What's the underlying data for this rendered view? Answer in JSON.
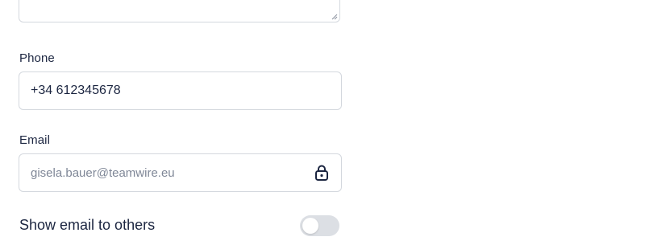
{
  "description_field": {
    "value": ""
  },
  "phone": {
    "label": "Phone",
    "value": "+34 612345678"
  },
  "email": {
    "label": "Email",
    "value": "gisela.bauer@teamwire.eu",
    "icon": "lock-icon",
    "locked": true
  },
  "show_email": {
    "label": "Show email to others",
    "enabled": false
  },
  "colors": {
    "text": "#1b2540",
    "border": "#d4d8de",
    "muted_text": "#7f8797",
    "toggle_off": "#dcdfe4"
  }
}
